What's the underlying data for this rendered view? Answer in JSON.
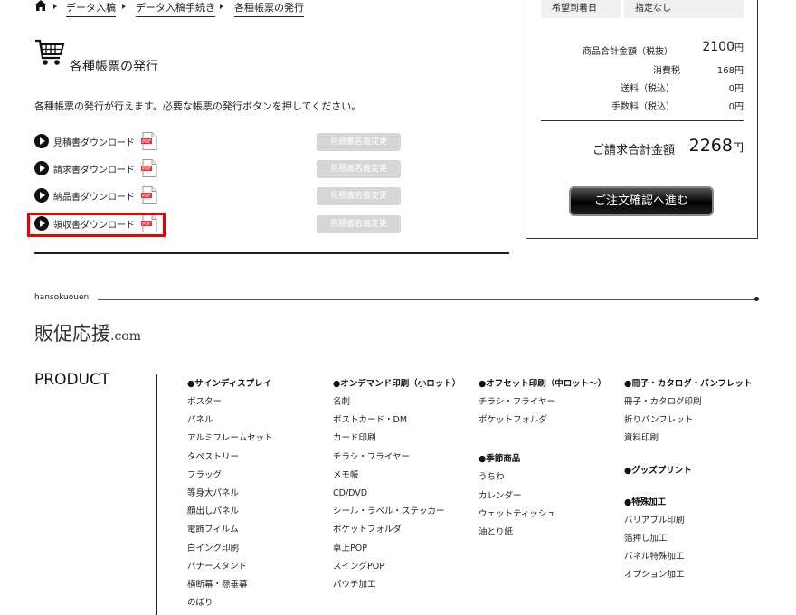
{
  "breadcrumb": {
    "items": [
      "データ入稿",
      "データ入稿手続き",
      "各種帳票の発行"
    ]
  },
  "page": {
    "title": "各種帳票の発行",
    "description": "各種帳票の発行が行えます。必要な帳票の発行ボタンを押してください。"
  },
  "downloads": [
    {
      "label": "見積書ダウンロード",
      "button": "見積書名義変更"
    },
    {
      "label": "請求書ダウンロード",
      "button": "見積書名義変更"
    },
    {
      "label": "納品書ダウンロード",
      "button": "見積書名義変更"
    },
    {
      "label": "領収書ダウンロード",
      "button": "見積書名義変更"
    }
  ],
  "pdf_badge": "PDF",
  "summary": {
    "delivery_label": "希望到着日",
    "delivery_value": "指定なし",
    "rows": [
      {
        "label": "商品合計金額（税抜）",
        "value": "2100",
        "unit": "円"
      },
      {
        "label": "消費税",
        "value": "168",
        "unit": "円"
      },
      {
        "label": "送料（税込）",
        "value": "0",
        "unit": "円"
      },
      {
        "label": "手数料（税込）",
        "value": "0",
        "unit": "円"
      }
    ],
    "total_label": "ご請求合計金額",
    "total_value": "2268",
    "total_unit": "円",
    "confirm_button": "ご注文確認へ進む"
  },
  "footer": {
    "brand_small": "hansokuouen",
    "logo_main": "販促応援",
    "logo_suffix": ".com",
    "product_heading": "PRODUCT",
    "columns": [
      {
        "sections": [
          {
            "title": "●サインディスプレイ",
            "items": [
              "ポスター",
              "パネル",
              "アルミフレームセット",
              "タペストリー",
              "フラッグ",
              "等身大パネル",
              "顔出しパネル",
              "電飾フィルム",
              "白インク印刷",
              "バナースタンド",
              "横断幕・懸垂幕",
              "のぼり"
            ]
          }
        ]
      },
      {
        "sections": [
          {
            "title": "●オンデマンド印刷（小ロット）",
            "items": [
              "名刺",
              "ポストカード・DM",
              "カード印刷",
              "チラシ・フライヤー",
              "メモ帳",
              "CD/DVD",
              "シール・ラベル・ステッカー",
              "ポケットフォルダ",
              "卓上POP",
              "スイングPOP",
              "パウチ加工"
            ]
          }
        ]
      },
      {
        "sections": [
          {
            "title": "●オフセット印刷（中ロット〜）",
            "items": [
              "チラシ・フライヤー",
              "ポケットフォルダ"
            ]
          },
          {
            "title": "●季節商品",
            "items": [
              "うちわ",
              "カレンダー",
              "ウェットティッシュ",
              "油とり紙"
            ]
          }
        ]
      },
      {
        "sections": [
          {
            "title": "●冊子・カタログ・パンフレット",
            "items": [
              "冊子・カタログ印刷",
              "折りパンフレット",
              "資料印刷"
            ]
          },
          {
            "title": "●グッズプリント",
            "items": []
          },
          {
            "title": "●特殊加工",
            "items": [
              "バリアブル印刷",
              "箔押し加工",
              "パネル特殊加工",
              "オプション加工"
            ]
          }
        ]
      }
    ]
  }
}
